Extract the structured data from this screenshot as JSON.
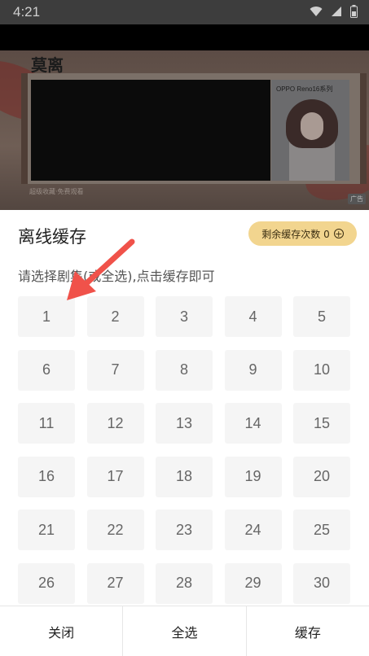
{
  "status_bar": {
    "time": "4:21",
    "icons": [
      "wifi-icon",
      "signal-icon",
      "battery-icon"
    ]
  },
  "video": {
    "logo": "莫离",
    "ad_title": "OPPO Reno16系列",
    "caption": "超级收藏·免费观看"
  },
  "sheet": {
    "title": "离线缓存",
    "remaining_label": "剩余缓存次数 0",
    "hint": "请选择剧集(或全选),点击缓存即可",
    "episodes": [
      "1",
      "2",
      "3",
      "4",
      "5",
      "6",
      "7",
      "8",
      "9",
      "10",
      "11",
      "12",
      "13",
      "14",
      "15",
      "16",
      "17",
      "18",
      "19",
      "20",
      "21",
      "22",
      "23",
      "24",
      "25",
      "26",
      "27",
      "28",
      "29",
      "30"
    ]
  },
  "actions": {
    "close": "关闭",
    "select_all": "全选",
    "cache": "缓存"
  },
  "colors": {
    "pill": "#f2d58f",
    "arrow": "#f0524a",
    "episode_bg": "#f5f5f5"
  }
}
